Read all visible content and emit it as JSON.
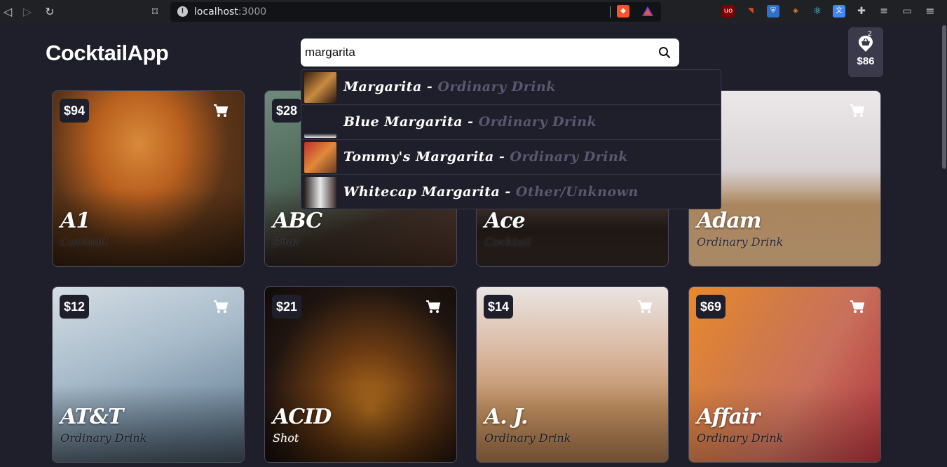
{
  "browser": {
    "url_host": "localhost",
    "url_port": ":3000"
  },
  "app": {
    "title": "CocktailApp"
  },
  "search": {
    "value": "margarita",
    "results": [
      {
        "name": "Margarita",
        "sep": " - ",
        "category": "Ordinary Drink"
      },
      {
        "name": "Blue Margarita",
        "sep": " - ",
        "category": "Ordinary Drink"
      },
      {
        "name": "Tommy's Margarita",
        "sep": " - ",
        "category": "Ordinary Drink"
      },
      {
        "name": "Whitecap Margarita",
        "sep": " - ",
        "category": "Other/Unknown"
      }
    ]
  },
  "cart": {
    "count": "2",
    "total": "$86"
  },
  "cards": [
    {
      "price": "$94",
      "name": "A1",
      "category": "Cocktail"
    },
    {
      "price": "$28",
      "name": "ABC",
      "category": "Shot"
    },
    {
      "price": "",
      "name": "Ace",
      "category": "Cocktail"
    },
    {
      "price": "",
      "name": "Adam",
      "category": "Ordinary Drink"
    },
    {
      "price": "$12",
      "name": "AT&T",
      "category": "Ordinary Drink"
    },
    {
      "price": "$21",
      "name": "ACID",
      "category": "Shot"
    },
    {
      "price": "$14",
      "name": "A. J.",
      "category": "Ordinary Drink"
    },
    {
      "price": "$69",
      "name": "Affair",
      "category": "Ordinary Drink"
    }
  ],
  "colors": {
    "background": "#1f1e2b",
    "card_border": "#4a4958",
    "dropdown_category": "#5a5870"
  }
}
